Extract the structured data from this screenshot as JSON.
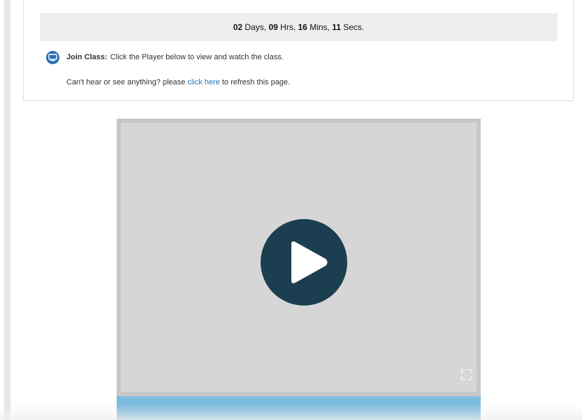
{
  "countdown": {
    "days_value": "02",
    "days_label": "Days,",
    "hours_value": "09",
    "hours_label": "Hrs,",
    "mins_value": "16",
    "mins_label": "Mins,",
    "secs_value": "11",
    "secs_label": "Secs."
  },
  "join": {
    "label": "Join Class:",
    "text": "Click the Player below to view and watch the class.",
    "icon": "monitor-icon"
  },
  "help": {
    "text_before": "Can't hear or see anything? please",
    "link_text": "click here",
    "text_after": "to refresh this page."
  },
  "player": {
    "play_icon": "play-icon",
    "fullscreen_icon": "expand-icon"
  },
  "colors": {
    "accent": "#2a72b5",
    "play_button": "#1b3f50",
    "control_bar": "#72b4da"
  }
}
